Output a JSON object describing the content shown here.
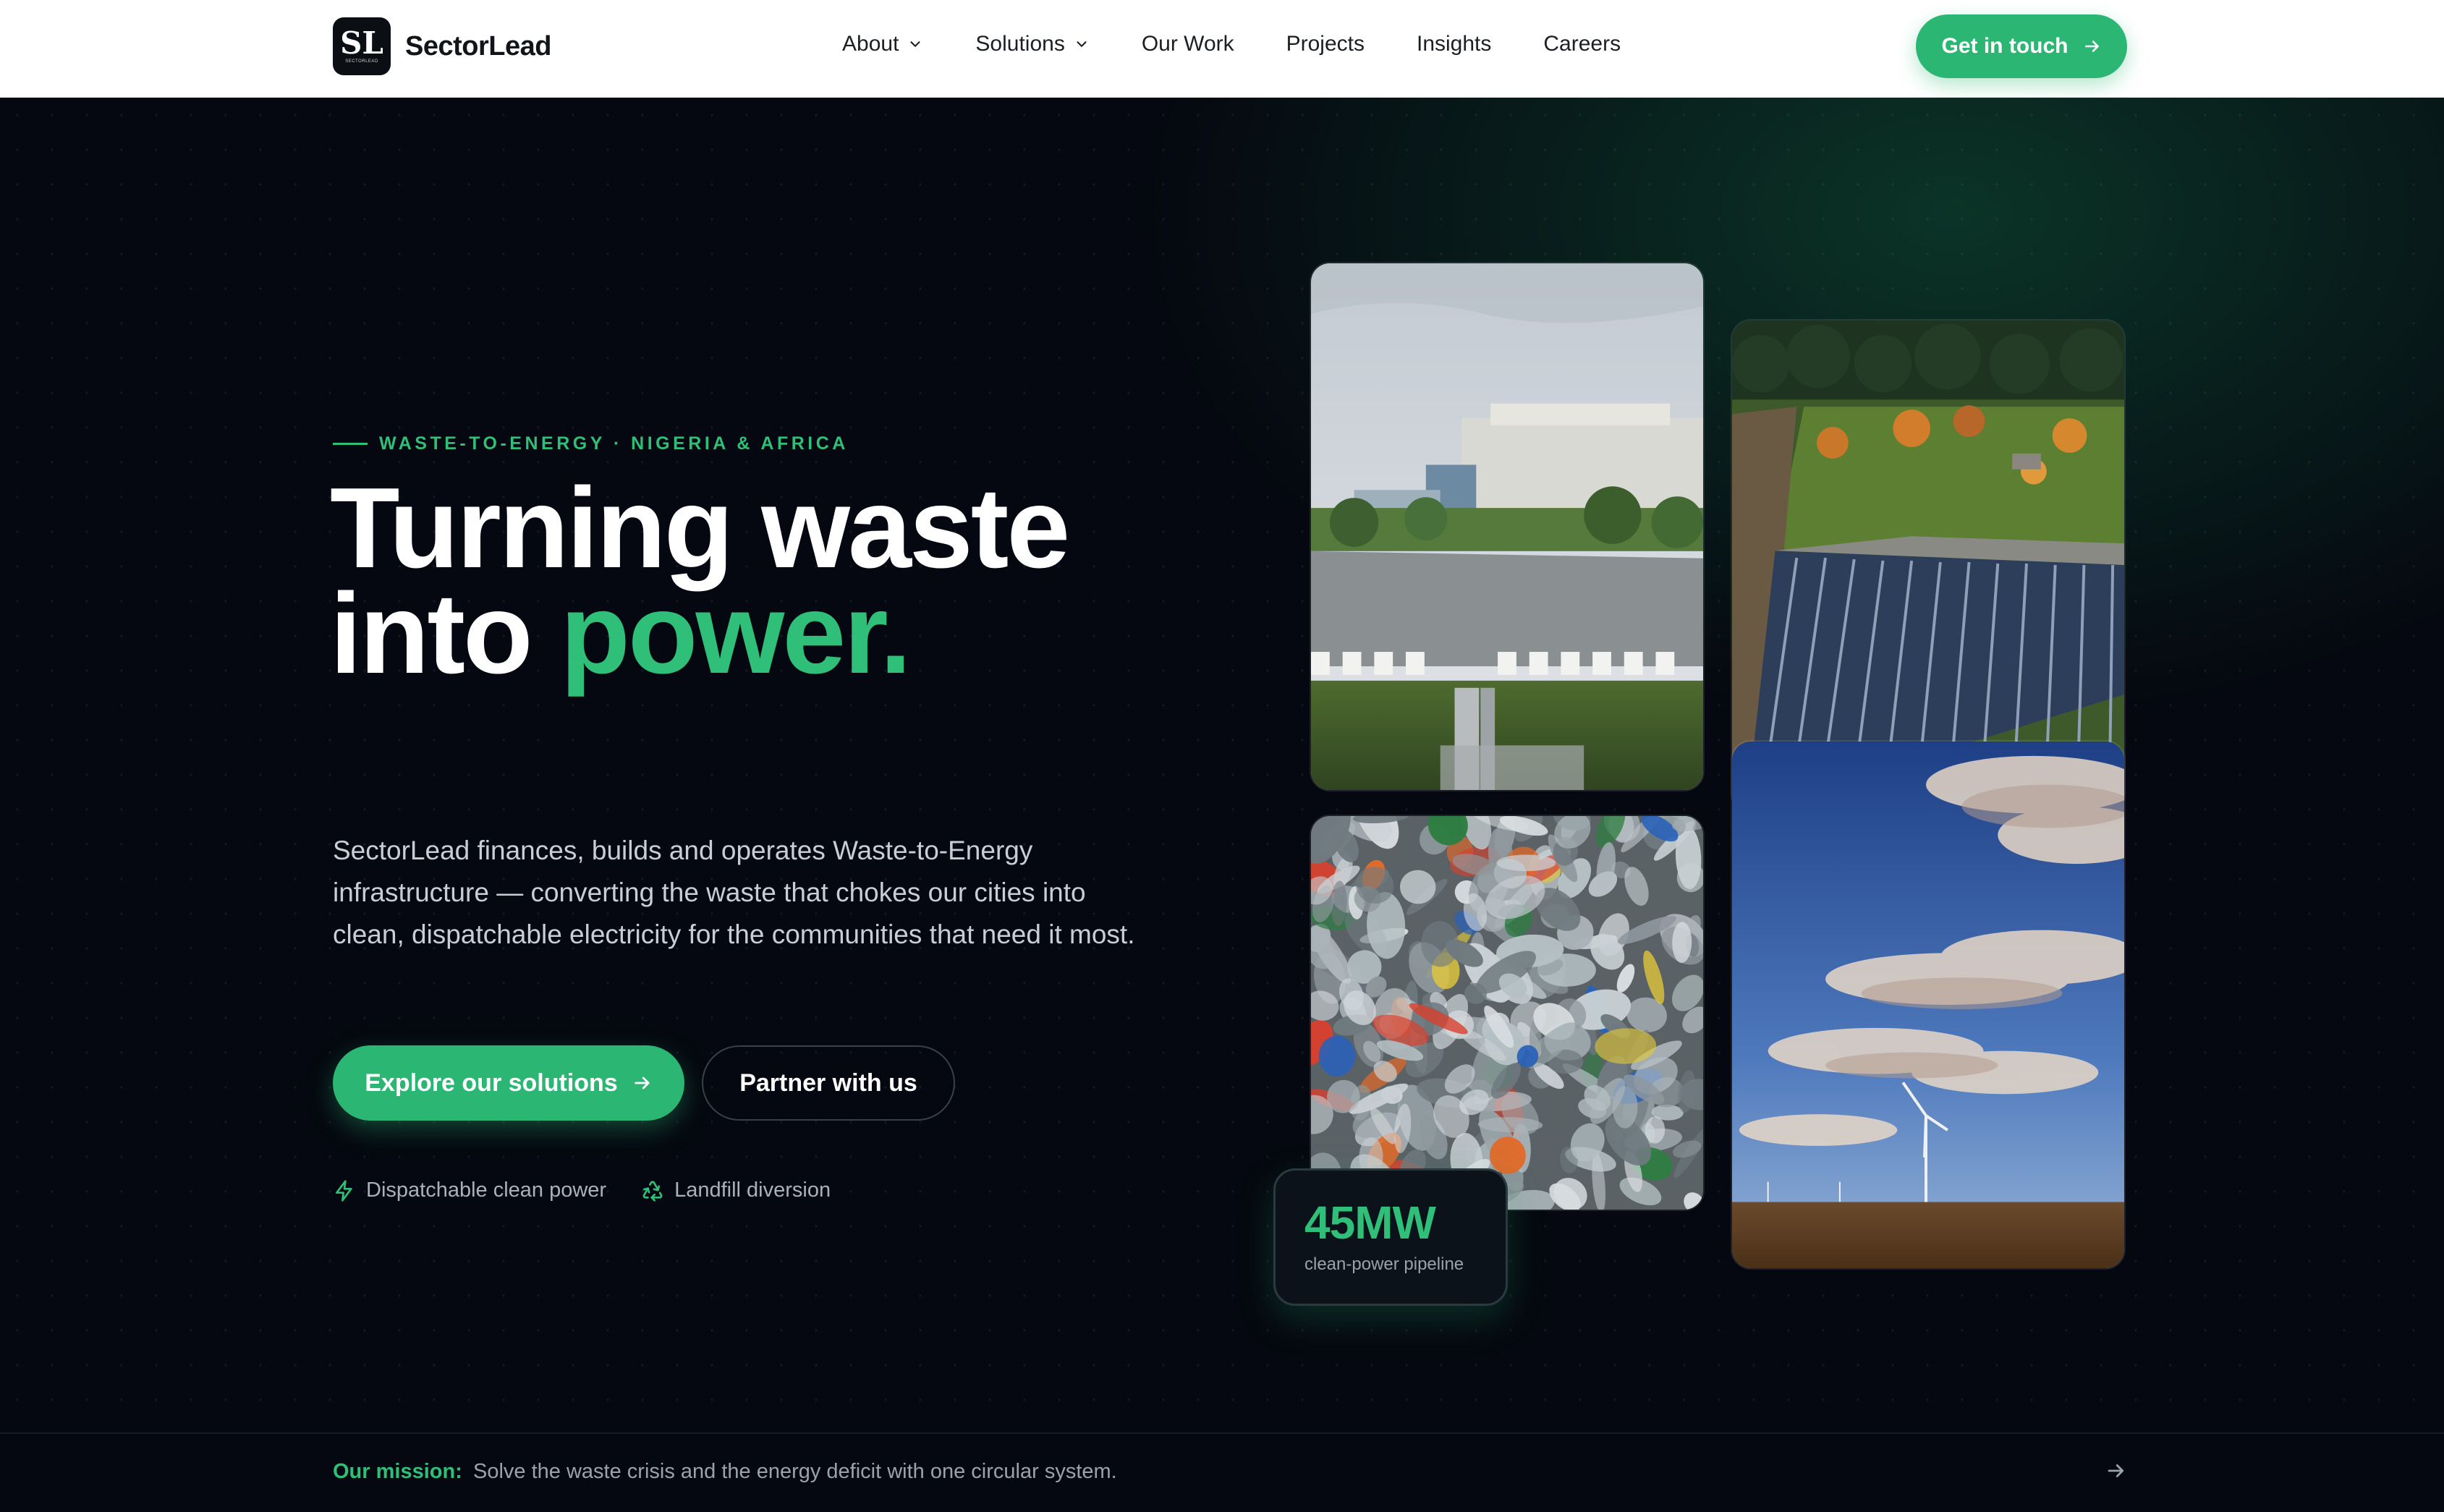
{
  "brand": {
    "name": "SectorLead",
    "mark_glyph": "SL",
    "mark_caption": "SECTORLEAD",
    "accent_color": "#2bb673"
  },
  "nav": {
    "items": [
      {
        "label": "About",
        "has_dropdown": true
      },
      {
        "label": "Solutions",
        "has_dropdown": true
      },
      {
        "label": "Our Work",
        "has_dropdown": false
      },
      {
        "label": "Projects",
        "has_dropdown": false
      },
      {
        "label": "Insights",
        "has_dropdown": false
      },
      {
        "label": "Careers",
        "has_dropdown": false
      }
    ],
    "cta_label": "Get in touch"
  },
  "hero": {
    "eyebrow": "WASTE-TO-ENERGY · NIGERIA & AFRICA",
    "headline_line1": "Turning waste",
    "headline_line2_prefix": "into ",
    "headline_line2_accent": "power.",
    "lede": "SectorLead finances, builds and operates Waste-to-Energy infrastructure — converting the waste that chokes our cities into clean, dispatchable electricity for the communities that need it most.",
    "primary_button": "Explore our solutions",
    "secondary_button": "Partner with us",
    "features": [
      {
        "icon": "lightning-icon",
        "label": "Dispatchable clean power"
      },
      {
        "icon": "recycle-icon",
        "label": "Landfill diversion"
      }
    ]
  },
  "gallery": [
    {
      "name": "waste-to-energy-plant-photo"
    },
    {
      "name": "solar-farm-aerial-photo"
    },
    {
      "name": "plastic-bottles-bale-photo"
    },
    {
      "name": "wind-turbine-field-photo"
    }
  ],
  "stat": {
    "value": "45MW",
    "label": "clean-power pipeline"
  },
  "mission": {
    "label": "Our mission:",
    "text": "Solve the waste crisis and the energy deficit with one circular system."
  }
}
